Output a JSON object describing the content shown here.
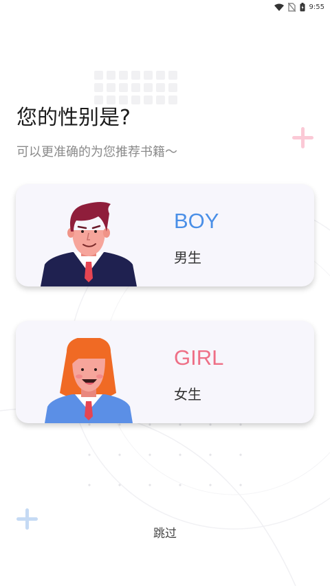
{
  "status_bar": {
    "time": "9:55",
    "icons": [
      "wifi-icon",
      "no-sim-icon",
      "battery-icon"
    ]
  },
  "title": "您的性别是?",
  "subtitle": "可以更准确的为您推荐书籍～",
  "options": {
    "boy": {
      "en": "BOY",
      "zh": "男生",
      "color": "#4a8fe7"
    },
    "girl": {
      "en": "GIRL",
      "zh": "女生",
      "color": "#ee6f86"
    }
  },
  "skip_label": "跳过",
  "colors": {
    "pink_plus": "#fbc9d6",
    "blue_plus": "#c5daf4",
    "card_bg": "#f7f6fc"
  }
}
